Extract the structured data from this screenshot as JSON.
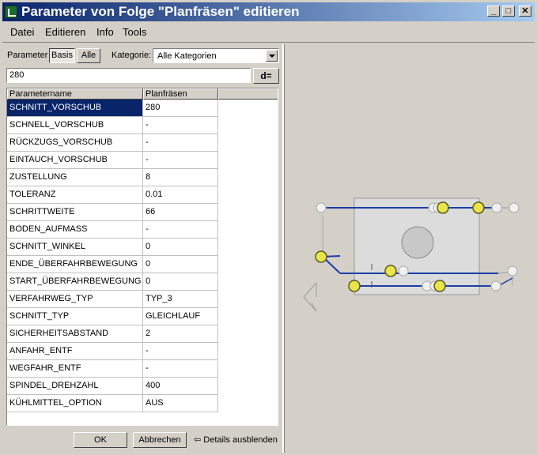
{
  "window": {
    "title": "Parameter von Folge \"Planfräsen\" editieren"
  },
  "titlebar_buttons": {
    "minimize": "_",
    "maximize": "□",
    "close": "✕"
  },
  "menu": [
    "Datei",
    "Editieren",
    "Info",
    "Tools"
  ],
  "filter": {
    "parameter_label": "Parameter",
    "basis_label": "Basis",
    "alle_label": "Alle",
    "kategorie_label": "Kategorie:",
    "kategorie_value": "Alle Kategorien"
  },
  "value_field": {
    "value": "280",
    "button_label": "d="
  },
  "table": {
    "headers": [
      "Parametername",
      "Planfräsen"
    ],
    "rows": [
      {
        "name": "SCHNITT_VORSCHUB",
        "value": "280"
      },
      {
        "name": "SCHNELL_VORSCHUB",
        "value": "-"
      },
      {
        "name": "RÜCKZUGS_VORSCHUB",
        "value": "-"
      },
      {
        "name": "EINTAUCH_VORSCHUB",
        "value": "-"
      },
      {
        "name": "ZUSTELLUNG",
        "value": "8"
      },
      {
        "name": "TOLERANZ",
        "value": "0.01"
      },
      {
        "name": "SCHRITTWEITE",
        "value": "66"
      },
      {
        "name": "BODEN_AUFMASS",
        "value": "-"
      },
      {
        "name": "SCHNITT_WINKEL",
        "value": "0"
      },
      {
        "name": "ENDE_ÜBERFAHRBEWEGUNG",
        "value": "0"
      },
      {
        "name": "START_ÜBERFAHRBEWEGUNG",
        "value": "0"
      },
      {
        "name": "VERFAHRWEG_TYP",
        "value": "TYP_3"
      },
      {
        "name": "SCHNITT_TYP",
        "value": "GLEICHLAUF"
      },
      {
        "name": "SICHERHEITSABSTAND",
        "value": "2"
      },
      {
        "name": "ANFAHR_ENTF",
        "value": "-"
      },
      {
        "name": "WEGFAHR_ENTF",
        "value": "-"
      },
      {
        "name": "SPINDEL_DREHZAHL",
        "value": "400"
      },
      {
        "name": "KÜHLMITTEL_OPTION",
        "value": "AUS"
      }
    ]
  },
  "footer": {
    "ok_label": "OK",
    "cancel_label": "Abbrechen",
    "details_label": "Details ausblenden"
  },
  "colors": {
    "title_start": "#0a246a",
    "title_end": "#a6caf0",
    "selection": "#0a246a",
    "path": "#1a3fa8",
    "point": "#e8e44a"
  }
}
